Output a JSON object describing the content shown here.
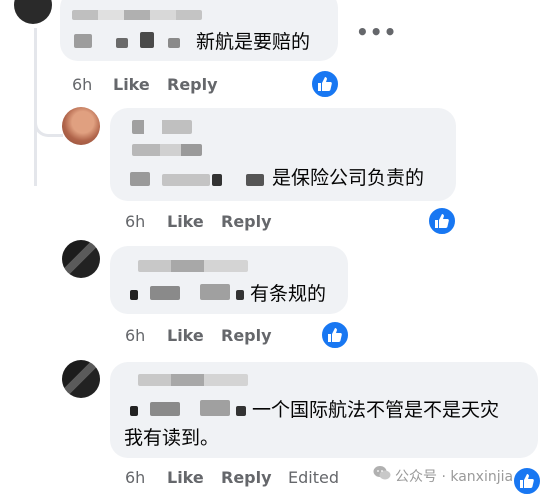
{
  "comments": [
    {
      "text": "新航是要赔的",
      "time": "6h",
      "like": "Like",
      "reply": "Reply"
    },
    {
      "text": "是保险公司负责的",
      "time": "6h",
      "like": "Like",
      "reply": "Reply"
    },
    {
      "text": "有条规的",
      "time": "6h",
      "like": "Like",
      "reply": "Reply"
    },
    {
      "text_line1": "一个国际航法不管是不是天灾",
      "text_line2": "我有读到。",
      "time": "6h",
      "like": "Like",
      "reply": "Reply",
      "edited": "Edited"
    }
  ],
  "more_label": "•••",
  "watermark": "公众号 · kanxinjia",
  "icons": [
    "thumbs-up-icon",
    "more-options-icon",
    "wechat-icon"
  ],
  "colors": {
    "bubble": "#f0f2f5",
    "meta": "#65676b",
    "like_blue": "#1877f2"
  }
}
